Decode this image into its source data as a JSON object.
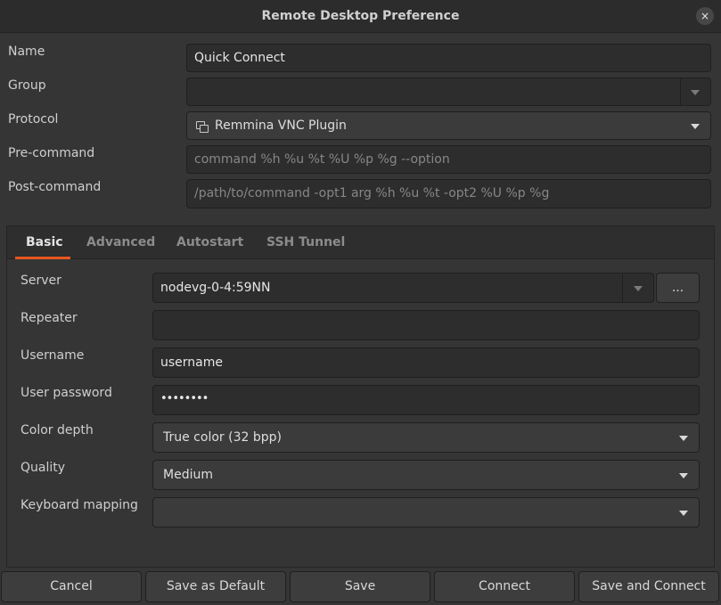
{
  "window": {
    "title": "Remote Desktop Preference",
    "close_glyph": "×"
  },
  "profile": {
    "name": {
      "label": "Name",
      "value": "Quick Connect"
    },
    "group": {
      "label": "Group",
      "value": ""
    },
    "protocol": {
      "label": "Protocol",
      "value": "Remmina VNC Plugin"
    },
    "pre_command": {
      "label": "Pre-command",
      "placeholder": "command %h %u %t %U %p %g --option"
    },
    "post_command": {
      "label": "Post-command",
      "placeholder": "/path/to/command -opt1 arg %h %u %t -opt2 %U %p %g"
    }
  },
  "tabs": [
    {
      "label": "Basic",
      "active": true
    },
    {
      "label": "Advanced",
      "active": false
    },
    {
      "label": "Autostart",
      "active": false
    },
    {
      "label": "SSH Tunnel",
      "active": false
    }
  ],
  "basic": {
    "server": {
      "label": "Server",
      "value": "nodevg-0-4:59NN",
      "browse_label": "..."
    },
    "repeater": {
      "label": "Repeater",
      "value": ""
    },
    "username": {
      "label": "Username",
      "value": "username"
    },
    "password": {
      "label": "User password",
      "value": "••••••••"
    },
    "color_depth": {
      "label": "Color depth",
      "value": "True color (32 bpp)"
    },
    "quality": {
      "label": "Quality",
      "value": "Medium"
    },
    "keyboard_mapping": {
      "label": "Keyboard mapping",
      "value": ""
    }
  },
  "buttons": {
    "cancel": "Cancel",
    "save_default": "Save as Default",
    "save": "Save",
    "connect": "Connect",
    "save_connect": "Save and Connect"
  },
  "colors": {
    "accent": "#e95420",
    "background": "#353535",
    "field": "#2d2d2d"
  }
}
